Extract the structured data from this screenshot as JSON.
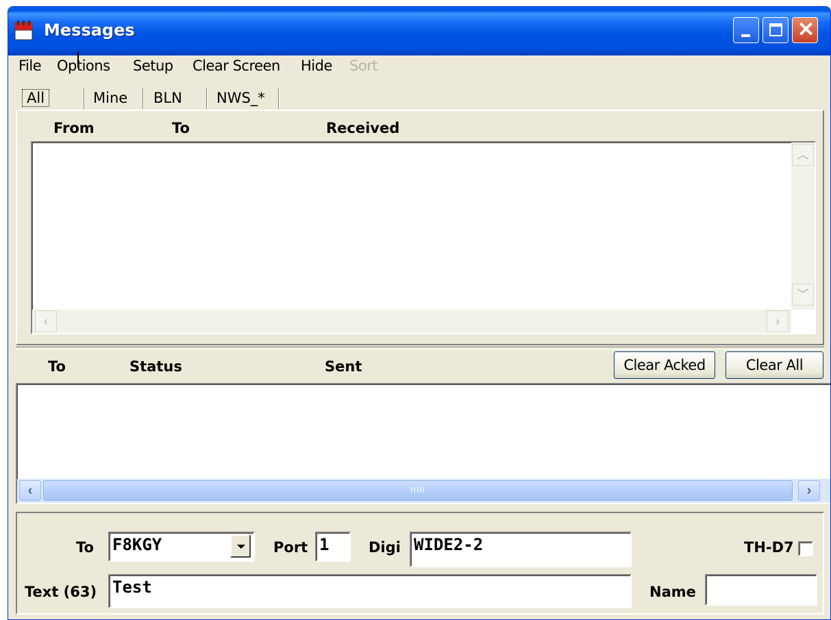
{
  "window": {
    "title": "Messages"
  },
  "menu": [
    "File",
    "Options",
    "Setup",
    "Clear Screen",
    "Hide",
    "Sort"
  ],
  "tabs": [
    "All",
    "Mine",
    "BLN",
    "NWS_*"
  ],
  "received_panel": {
    "columns": [
      "From",
      "To",
      "Received"
    ],
    "rows": []
  },
  "sent_panel": {
    "columns": [
      "To",
      "Status",
      "Sent"
    ],
    "rows": [],
    "clear_acked_label": "Clear Acked",
    "clear_all_label": "Clear All",
    "scroll_grip": "IIIII"
  },
  "compose": {
    "to_label": "To",
    "to_value": "F8KGY",
    "port_label": "Port",
    "port_value": "1",
    "digi_label": "Digi",
    "digi_value": "WIDE2-2",
    "thd7_label": "TH-D7",
    "thd7_checked": false,
    "text_label": "Text (63)",
    "text_value": "Test",
    "name_label": "Name",
    "name_value": ""
  },
  "colors": {
    "titlebar": "#0054e3",
    "face": "#ece9d8",
    "close_button": "#c8402a"
  }
}
